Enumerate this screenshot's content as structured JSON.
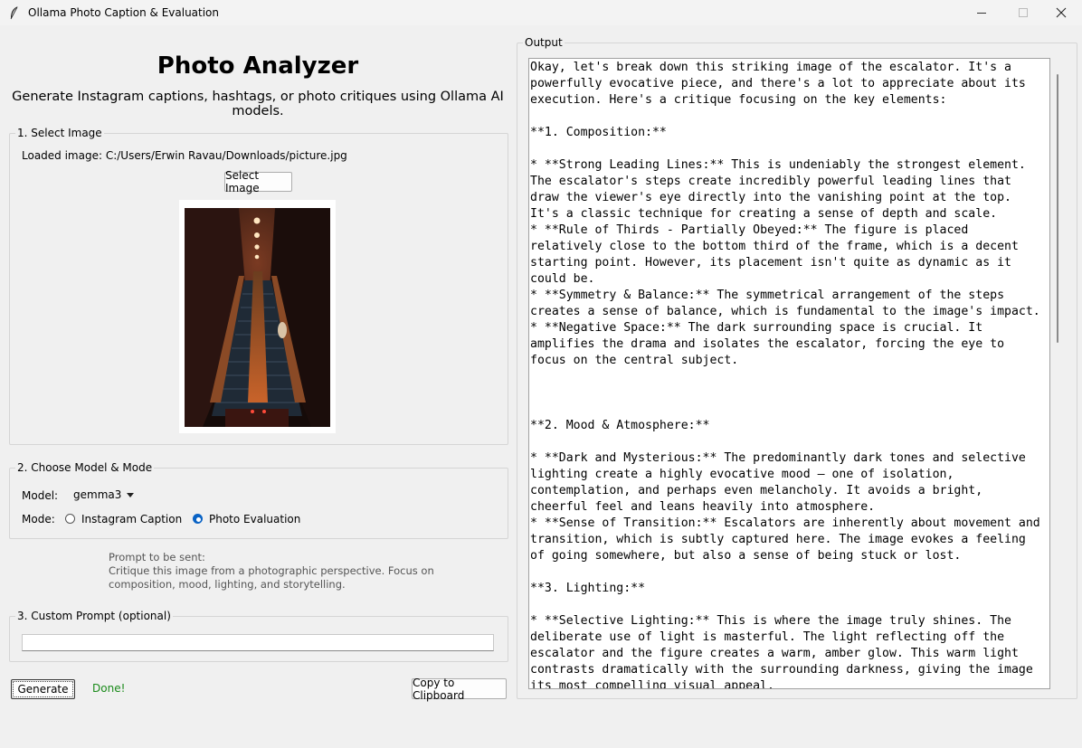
{
  "window": {
    "title": "Ollama Photo Caption & Evaluation",
    "icon": "feather-icon"
  },
  "header": {
    "title": "Photo Analyzer",
    "subtitle": "Generate Instagram captions, hashtags, or photo critiques using Ollama AI models."
  },
  "select_image": {
    "group_label": "1. Select Image",
    "loaded_text": "Loaded image: C:/Users/Erwin Ravau/Downloads/picture.jpg",
    "button_label": "Select Image",
    "preview_icon": "escalator-photo"
  },
  "model_mode": {
    "group_label": "2. Choose Model & Mode",
    "model_label": "Model:",
    "model_value": "gemma3",
    "mode_label": "Mode:",
    "modes": [
      {
        "label": "Instagram Caption",
        "selected": false
      },
      {
        "label": "Photo Evaluation",
        "selected": true
      }
    ]
  },
  "prompt_preview": {
    "label": "Prompt to be sent:",
    "text": "Critique this image from a photographic perspective. Focus on composition, mood, lighting, and storytelling."
  },
  "custom_prompt": {
    "group_label": "3. Custom Prompt (optional)",
    "value": ""
  },
  "actions": {
    "generate_label": "Generate",
    "status": "Done!",
    "copy_label": "Copy to Clipboard"
  },
  "output": {
    "group_label": "Output",
    "text": "Okay, let's break down this striking image of the escalator. It's a\npowerfully evocative piece, and there's a lot to appreciate about its\nexecution. Here's a critique focusing on the key elements:\n\n**1. Composition:**\n\n* **Strong Leading Lines:** This is undeniably the strongest element.\nThe escalator's steps create incredibly powerful leading lines that\ndraw the viewer's eye directly into the vanishing point at the top.\nIt's a classic technique for creating a sense of depth and scale.\n* **Rule of Thirds - Partially Obeyed:** The figure is placed\nrelatively close to the bottom third of the frame, which is a decent\nstarting point. However, its placement isn't quite as dynamic as it\ncould be.\n* **Symmetry & Balance:** The symmetrical arrangement of the steps\ncreates a sense of balance, which is fundamental to the image's impact.\n* **Negative Space:** The dark surrounding space is crucial. It\namplifies the drama and isolates the escalator, forcing the eye to\nfocus on the central subject.\n\n\n\n**2. Mood & Atmosphere:**\n\n* **Dark and Mysterious:** The predominantly dark tones and selective\nlighting create a highly evocative mood – one of isolation,\ncontemplation, and perhaps even melancholy. It avoids a bright,\ncheerful feel and leans heavily into atmosphere.\n* **Sense of Transition:** Escalators are inherently about movement and\ntransition, which is subtly captured here. The image evokes a feeling\nof going somewhere, but also a sense of being stuck or lost.\n\n**3. Lighting:**\n\n* **Selective Lighting:** This is where the image truly shines. The\ndeliberate use of light is masterful. The light reflecting off the\nescalator and the figure creates a warm, amber glow. This warm light\ncontrasts dramatically with the surrounding darkness, giving the image\nits most compelling visual appeal."
  },
  "colors": {
    "accent": "#0a63c5",
    "status": "#1a8a1a",
    "background": "#f0f0f0"
  }
}
